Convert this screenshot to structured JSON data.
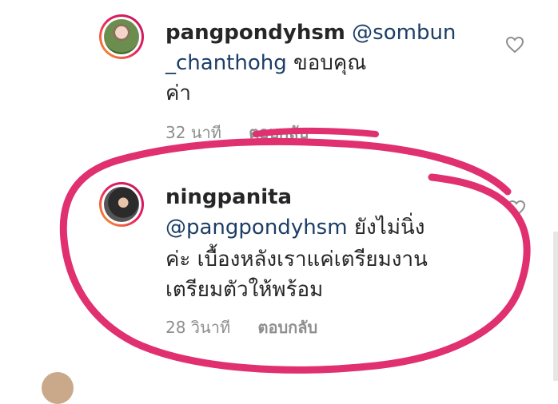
{
  "comments": [
    {
      "username": "pangpondyhsm",
      "mention": "@sombun",
      "mention_cont": "_chanthohg",
      "text_after_mention": " ขอบคุณ",
      "text_line3": "ค่า",
      "time": "32 นาที",
      "reply_label": "ตอบกลับ"
    },
    {
      "username": "ningpanita",
      "mention": "@pangpondyhsm",
      "text_line1_after": " ยังไม่นิ่ง",
      "text_line2": "ค่ะ เบื้องหลังเราแค่เตรียมงาน",
      "text_line3": "เตรียมตัวให้พร้อม",
      "time": "28 วินาที",
      "reply_label": "ตอบกลับ"
    }
  ],
  "colors": {
    "highlight_ring": "#e0306f",
    "mention": "#1c3e66",
    "meta": "#8e8e8e"
  },
  "icons": [
    "heart-icon"
  ]
}
